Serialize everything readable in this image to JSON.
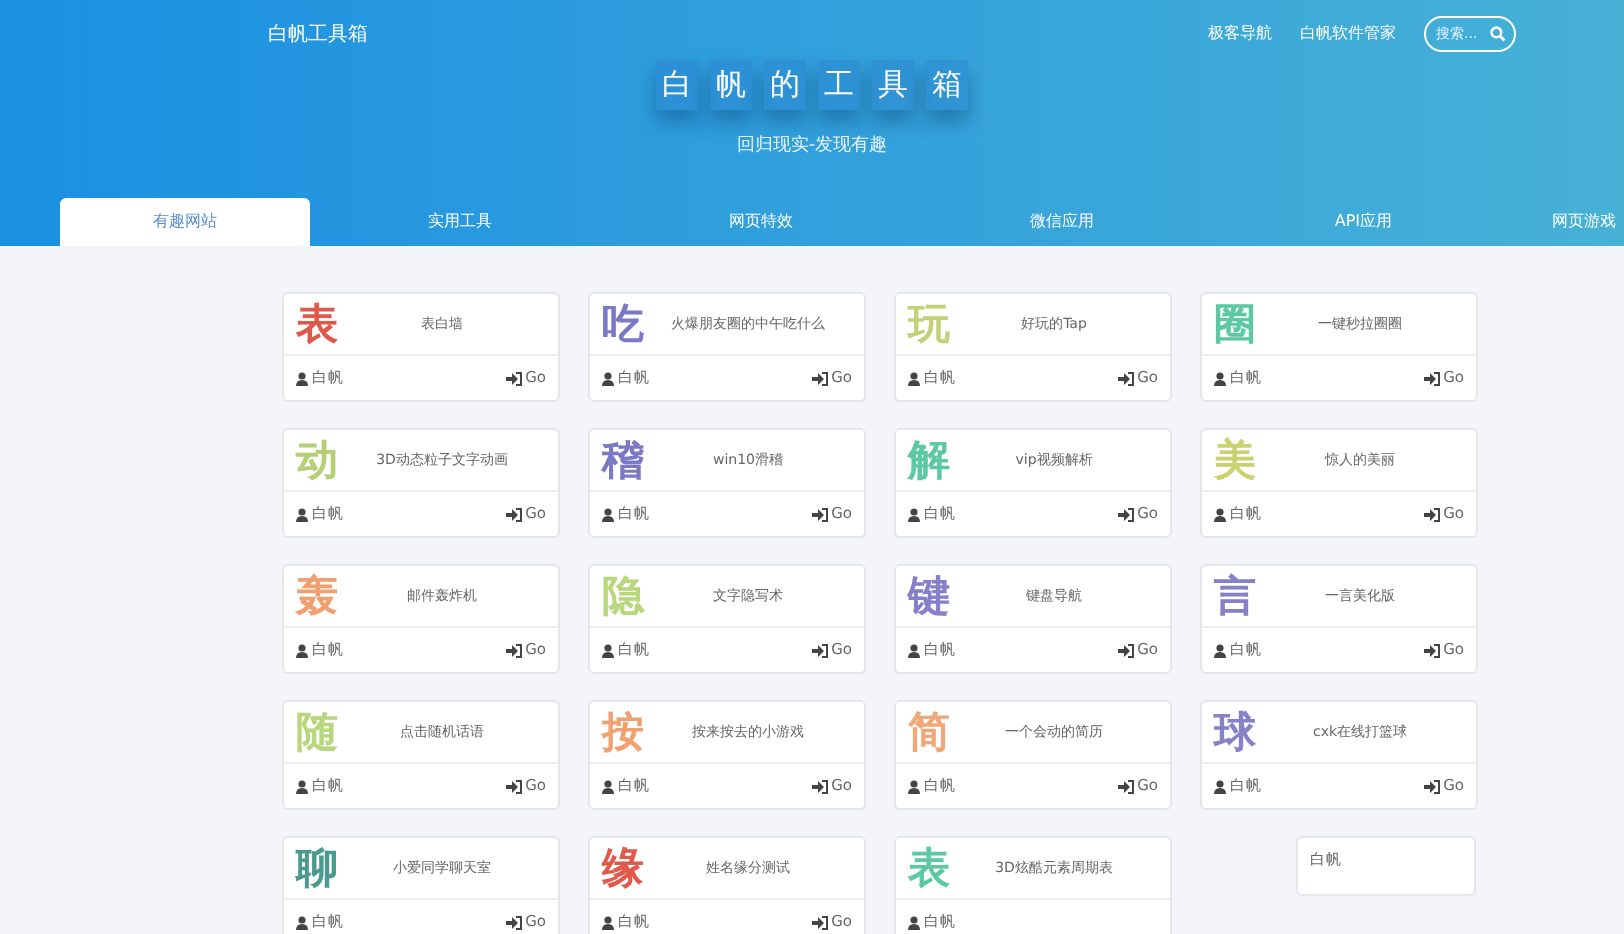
{
  "brand": "白帆工具箱",
  "top_links": [
    "极客导航",
    "白帆软件管家"
  ],
  "search": {
    "placeholder": "搜索..."
  },
  "hero": {
    "title_chars": [
      "白",
      "帆",
      "的",
      "工",
      "具",
      "箱"
    ],
    "subtitle": "回归现实-发现有趣"
  },
  "tabs": [
    {
      "label": "有趣网站",
      "selected": true
    },
    {
      "label": "实用工具",
      "selected": false
    },
    {
      "label": "网页特效",
      "selected": false
    },
    {
      "label": "微信应用",
      "selected": false
    },
    {
      "label": "API应用",
      "selected": false
    },
    {
      "label": "网页游戏",
      "selected": false
    }
  ],
  "cards": [
    {
      "char": "表",
      "color": "#e0584a",
      "desc": "表白墙",
      "author": "白帆",
      "go": "Go"
    },
    {
      "char": "吃",
      "color": "#7b79c4",
      "desc": "火爆朋友圈的中午吃什么",
      "author": "白帆",
      "go": "Go"
    },
    {
      "char": "玩",
      "color": "#c5d07a",
      "desc": "好玩的Tap",
      "author": "白帆",
      "go": "Go"
    },
    {
      "char": "圈",
      "color": "#5cc9a0",
      "desc": "一键秒拉圈圈",
      "author": "白帆",
      "go": "Go"
    },
    {
      "char": "动",
      "color": "#b5cf76",
      "desc": "3D动态粒子文字动画",
      "author": "白帆",
      "go": "Go"
    },
    {
      "char": "稽",
      "color": "#7b79c4",
      "desc": "win10滑稽",
      "author": "白帆",
      "go": "Go"
    },
    {
      "char": "解",
      "color": "#5cc9a0",
      "desc": "vip视频解析",
      "author": "白帆",
      "go": "Go"
    },
    {
      "char": "美",
      "color": "#c8d270",
      "desc": "惊人的美丽",
      "author": "白帆",
      "go": "Go"
    },
    {
      "char": "轰",
      "color": "#f0a070",
      "desc": "邮件轰炸机",
      "author": "白帆",
      "go": "Go"
    },
    {
      "char": "隐",
      "color": "#b8d67a",
      "desc": "文字隐写术",
      "author": "白帆",
      "go": "Go"
    },
    {
      "char": "键",
      "color": "#8580c8",
      "desc": "键盘导航",
      "author": "白帆",
      "go": "Go"
    },
    {
      "char": "言",
      "color": "#8581c9",
      "desc": "一言美化版",
      "author": "白帆",
      "go": "Go"
    },
    {
      "char": "随",
      "color": "#b8d67b",
      "desc": "点击随机话语",
      "author": "白帆",
      "go": "Go"
    },
    {
      "char": "按",
      "color": "#f0a071",
      "desc": "按来按去的小游戏",
      "author": "白帆",
      "go": "Go"
    },
    {
      "char": "简",
      "color": "#f0a878",
      "desc": "一个会动的简历",
      "author": "白帆",
      "go": "Go"
    },
    {
      "char": "球",
      "color": "#8582c8",
      "desc": "cxk在线打篮球",
      "author": "白帆",
      "go": "Go"
    },
    {
      "char": "聊",
      "color": "#4a9a90",
      "desc": "小爱同学聊天室",
      "author": "白帆",
      "go": "Go"
    },
    {
      "char": "缘",
      "color": "#e0594a",
      "desc": "姓名缘分测试",
      "author": "白帆",
      "go": "Go"
    },
    {
      "char": "表",
      "color": "#5cc9a1",
      "desc": "3D炫酷元素周期表",
      "author": "白帆"
    }
  ],
  "popup": {
    "text": "白帆"
  }
}
